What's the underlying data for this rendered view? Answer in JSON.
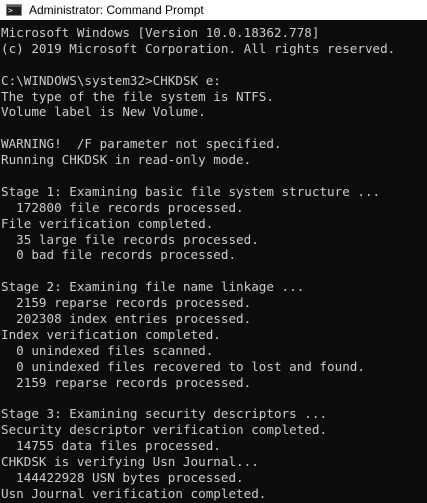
{
  "window": {
    "title": "Administrator: Command Prompt",
    "icon": "cmd-icon"
  },
  "colors": {
    "background": "#0c0c0c",
    "text": "#cccccc",
    "titlebar": "#ffffff"
  },
  "console": {
    "lines": [
      "Microsoft Windows [Version 10.0.18362.778]",
      "(c) 2019 Microsoft Corporation. All rights reserved.",
      "",
      "C:\\WINDOWS\\system32>CHKDSK e:",
      "The type of the file system is NTFS.",
      "Volume label is New Volume.",
      "",
      "WARNING!  /F parameter not specified.",
      "Running CHKDSK in read-only mode.",
      "",
      "Stage 1: Examining basic file system structure ...",
      "  172800 file records processed.",
      "File verification completed.",
      "  35 large file records processed.",
      "  0 bad file records processed.",
      "",
      "Stage 2: Examining file name linkage ...",
      "  2159 reparse records processed.",
      "  202308 index entries processed.",
      "Index verification completed.",
      "  0 unindexed files scanned.",
      "  0 unindexed files recovered to lost and found.",
      "  2159 reparse records processed.",
      "",
      "Stage 3: Examining security descriptors ...",
      "Security descriptor verification completed.",
      "  14755 data files processed.",
      "CHKDSK is verifying Usn Journal...",
      "  144422928 USN bytes processed.",
      "Usn Journal verification completed."
    ]
  }
}
